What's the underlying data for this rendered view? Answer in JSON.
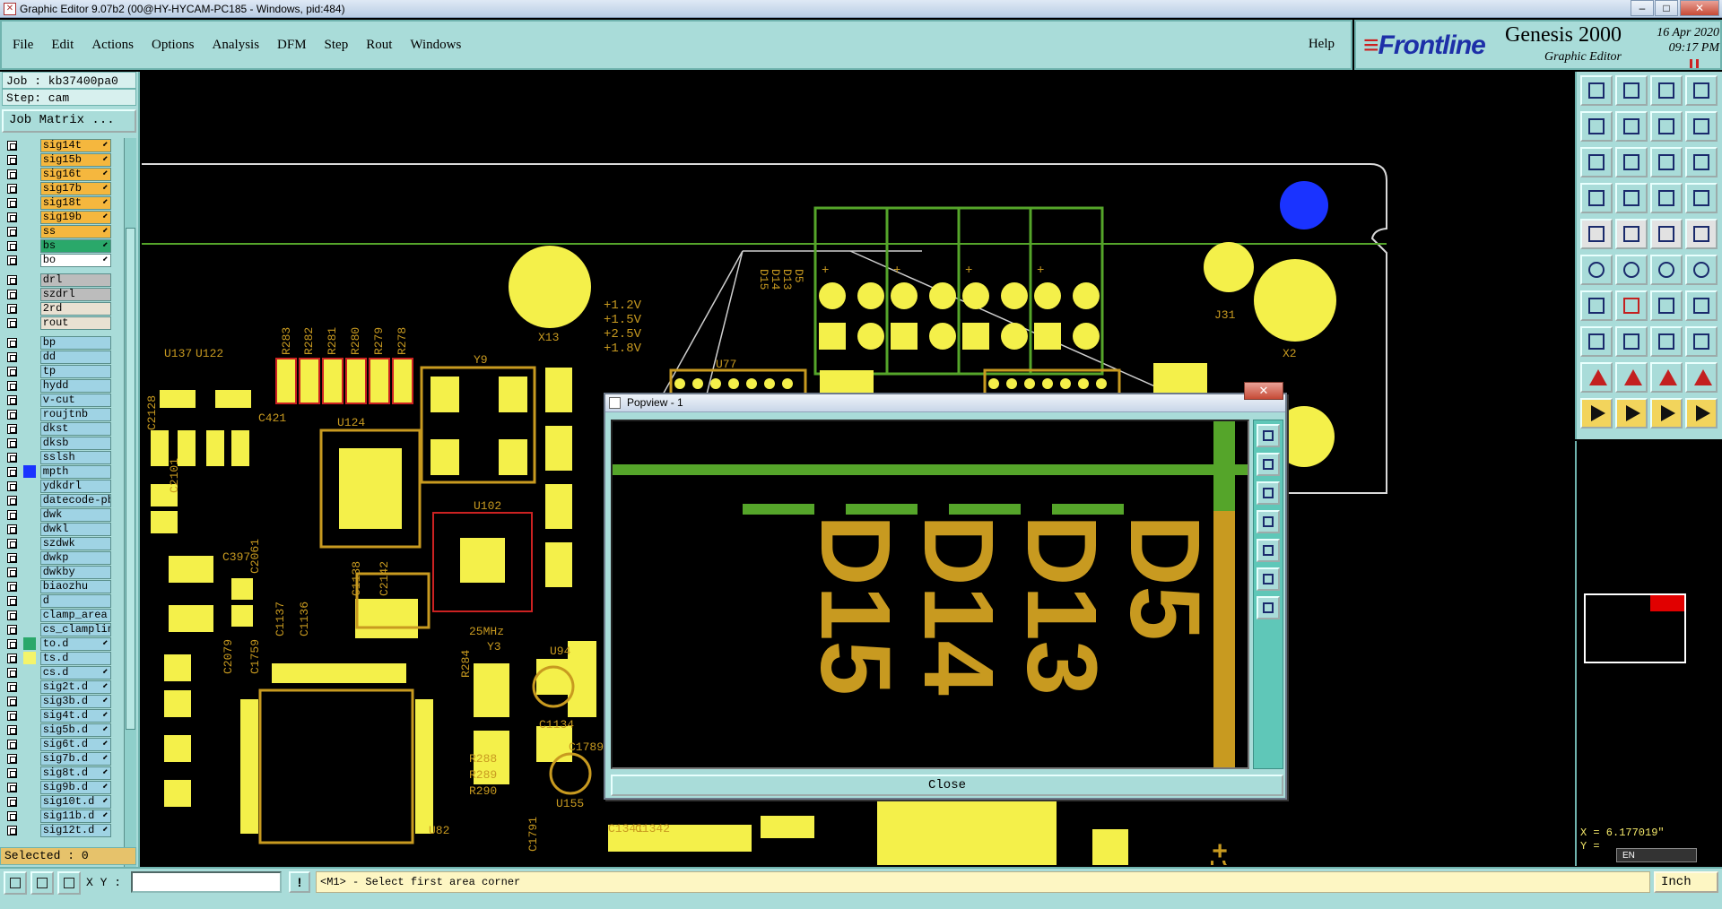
{
  "window": {
    "title": "Graphic Editor 9.07b2 (00@HY-HYCAM-PC185 - Windows, pid:484)",
    "controls": [
      "–",
      "□",
      "✕"
    ]
  },
  "menu": [
    "File",
    "Edit",
    "Actions",
    "Options",
    "Analysis",
    "DFM",
    "Step",
    "Rout",
    "Windows"
  ],
  "help": "Help",
  "brand": {
    "logo": "Frontline",
    "product": "Genesis 2000",
    "subtitle": "Graphic Editor",
    "date": "16 Apr 2020",
    "time": "09:17 PM"
  },
  "job": {
    "job_line": "Job : kb37400pa0",
    "step_line": "Step: cam",
    "matrix_button": "Job Matrix ..."
  },
  "layer_groups": [
    [
      {
        "name": "sig14t",
        "color": "#f5b73e",
        "mk": "⬋"
      },
      {
        "name": "sig15b",
        "color": "#f5b73e",
        "mk": "⬋"
      },
      {
        "name": "sig16t",
        "color": "#f5b73e",
        "mk": "⬋"
      },
      {
        "name": "sig17b",
        "color": "#f5b73e",
        "mk": "⬋"
      },
      {
        "name": "sig18t",
        "color": "#f5b73e",
        "mk": "⬋"
      },
      {
        "name": "sig19b",
        "color": "#f5b73e",
        "mk": "⬋"
      },
      {
        "name": "ss",
        "color": "#f5b73e",
        "mk": "⬋"
      },
      {
        "name": "bs",
        "color": "#2aa86a",
        "mk": "⬋"
      },
      {
        "name": "bo",
        "color": "#ffffff",
        "mk": "⬋"
      }
    ],
    [
      {
        "name": "drl",
        "color": "#bcbcbc",
        "mk": ""
      },
      {
        "name": "szdrl",
        "color": "#bcbcbc",
        "mk": ""
      },
      {
        "name": "2rd",
        "color": "#e9e1d2",
        "mk": ""
      },
      {
        "name": "rout",
        "color": "#e9e1d2",
        "mk": ""
      }
    ],
    [
      {
        "name": "bp",
        "color": "#9fd3e4",
        "mk": ""
      },
      {
        "name": "dd",
        "color": "#9fd3e4",
        "mk": ""
      },
      {
        "name": "tp",
        "color": "#9fd3e4",
        "mk": ""
      },
      {
        "name": "hydd",
        "color": "#9fd3e4",
        "mk": ""
      },
      {
        "name": "v-cut",
        "color": "#9fd3e4",
        "mk": ""
      },
      {
        "name": "roujtnb",
        "color": "#9fd3e4",
        "mk": ""
      },
      {
        "name": "dkst",
        "color": "#9fd3e4",
        "mk": ""
      },
      {
        "name": "dksb",
        "color": "#9fd3e4",
        "mk": ""
      },
      {
        "name": "sslsh",
        "color": "#9fd3e4",
        "mk": ""
      },
      {
        "name": "mpth",
        "color": "#9fd3e4",
        "mk": "",
        "swatch": "#1a33ff"
      },
      {
        "name": "ydkdrl",
        "color": "#9fd3e4",
        "mk": ""
      },
      {
        "name": "datecode-pb",
        "color": "#9fd3e4",
        "mk": ""
      },
      {
        "name": "dwk",
        "color": "#9fd3e4",
        "mk": ""
      },
      {
        "name": "dwkl",
        "color": "#9fd3e4",
        "mk": ""
      },
      {
        "name": "szdwk",
        "color": "#9fd3e4",
        "mk": ""
      },
      {
        "name": "dwkp",
        "color": "#9fd3e4",
        "mk": ""
      },
      {
        "name": "dwkby",
        "color": "#9fd3e4",
        "mk": ""
      },
      {
        "name": "biaozhu",
        "color": "#9fd3e4",
        "mk": ""
      },
      {
        "name": "d",
        "color": "#9fd3e4",
        "mk": ""
      },
      {
        "name": "clamp_area",
        "color": "#9fd3e4",
        "mk": ""
      },
      {
        "name": "cs_clampline",
        "color": "#9fd3e4",
        "mk": ""
      },
      {
        "name": "to.d",
        "color": "#9fd3e4",
        "mk": "⬋",
        "swatch": "#2aa86a"
      },
      {
        "name": "ts.d",
        "color": "#9fd3e4",
        "mk": "",
        "swatch": "#f4f46a"
      },
      {
        "name": "cs.d",
        "color": "#9fd3e4",
        "mk": "⬋"
      },
      {
        "name": "sig2t.d",
        "color": "#9fd3e4",
        "mk": "⬋"
      },
      {
        "name": "sig3b.d",
        "color": "#9fd3e4",
        "mk": "⬋"
      },
      {
        "name": "sig4t.d",
        "color": "#9fd3e4",
        "mk": "⬋"
      },
      {
        "name": "sig5b.d",
        "color": "#9fd3e4",
        "mk": "⬋"
      },
      {
        "name": "sig6t.d",
        "color": "#9fd3e4",
        "mk": "⬋"
      },
      {
        "name": "sig7b.d",
        "color": "#9fd3e4",
        "mk": "⬋"
      },
      {
        "name": "sig8t.d",
        "color": "#9fd3e4",
        "mk": "⬋"
      },
      {
        "name": "sig9b.d",
        "color": "#9fd3e4",
        "mk": "⬋"
      },
      {
        "name": "sig10t.d",
        "color": "#9fd3e4",
        "mk": "⬋"
      },
      {
        "name": "sig11b.d",
        "color": "#9fd3e4",
        "mk": "⬋"
      },
      {
        "name": "sig12t.d",
        "color": "#9fd3e4",
        "mk": "⬋"
      }
    ]
  ],
  "selected": "Selected : 0",
  "board_labels": {
    "refdes": [
      "U137",
      "U122",
      "R283",
      "R282",
      "R281",
      "R280",
      "R279",
      "R278",
      "Y9",
      "U77",
      "C421",
      "U124",
      "U102",
      "C2128",
      "C2101",
      "C397",
      "C2061",
      "C1136",
      "C1137",
      "C1138",
      "C2142",
      "C1759",
      "C2079",
      "R284",
      "Y3",
      "U94",
      "C1134",
      "C1789",
      "R288",
      "R289",
      "R290",
      "U155",
      "U82",
      "C1342",
      "C1341",
      "C1791",
      "J31",
      "X2",
      "X13",
      "D15",
      "D14",
      "D13",
      "D5",
      "+1.2V",
      "+1.5V",
      "+2.5V",
      "+1.8V",
      "25MHz"
    ],
    "volt_text": "+1.2V"
  },
  "popview": {
    "title": "Popview - 1",
    "labels": [
      "D15",
      "D14",
      "D13",
      "D5"
    ],
    "close": "Close",
    "close_x": "✕"
  },
  "coords": {
    "x": "X = 6.177019\"",
    "y": "Y ="
  },
  "ime": "EN",
  "status": {
    "xy_label": "X Y :",
    "xy_value": "",
    "msg_icon": "!",
    "prompt": "<M1> - Select first area corner",
    "units": "Inch"
  },
  "colors": {
    "panel": "#a9dcd9",
    "copper": "#f4f04a",
    "silk": "#c89a20",
    "outline": "#55a52a",
    "hole": "#1a33ff"
  }
}
